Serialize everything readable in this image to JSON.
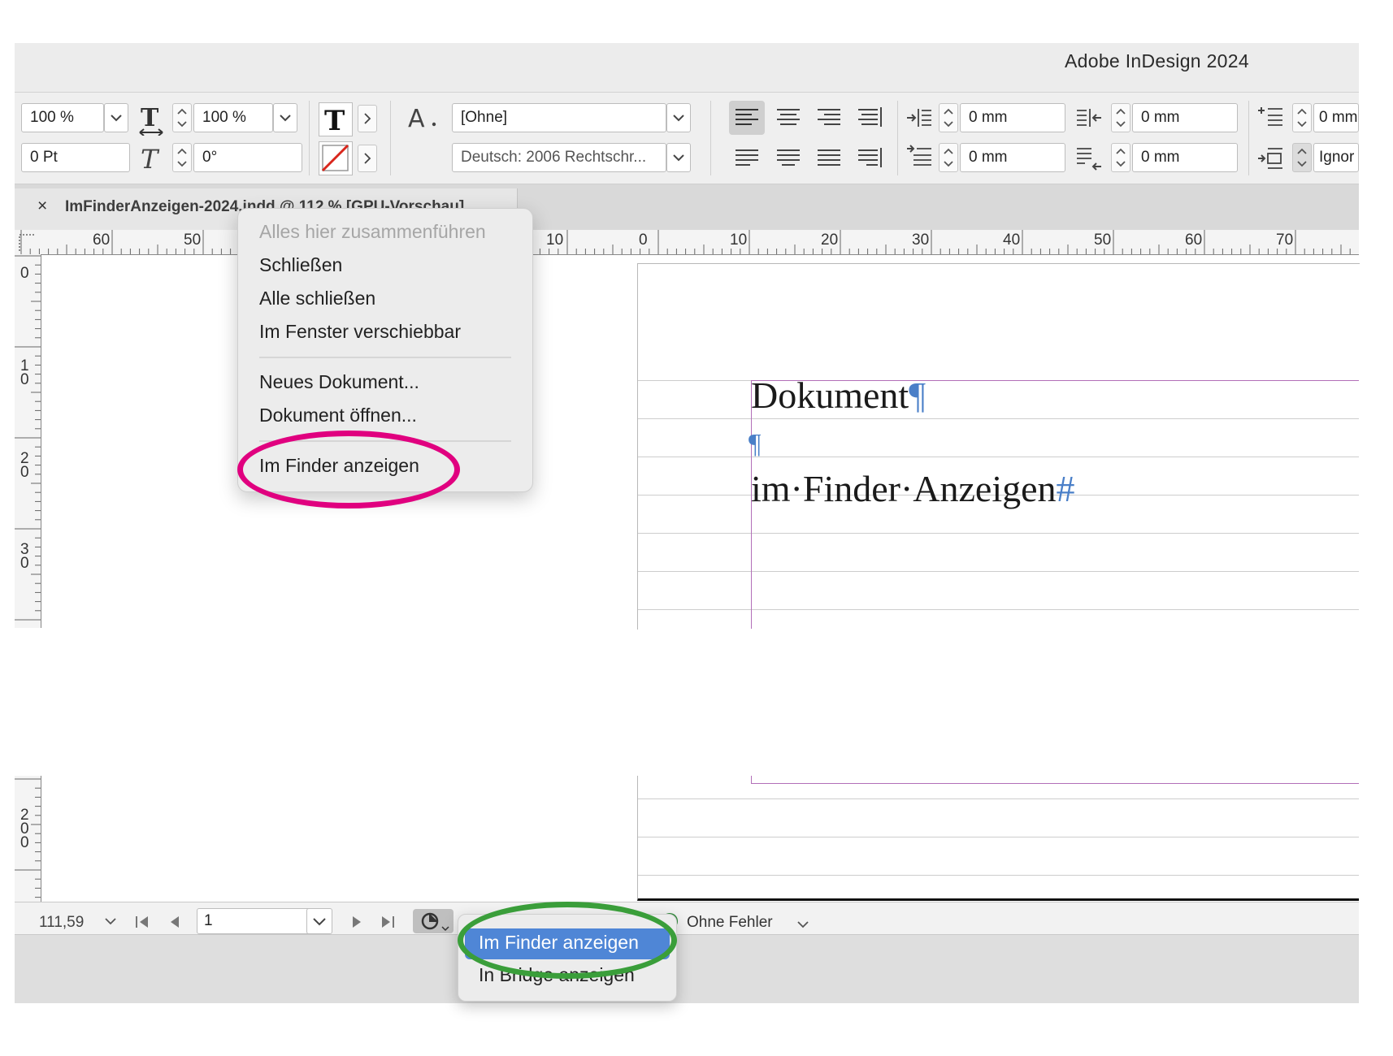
{
  "app": {
    "title": "Adobe InDesign 2024"
  },
  "control_bar": {
    "horizontal_scale": "100 %",
    "vertical_scale": "100 %",
    "baseline_shift": "0 Pt",
    "skew": "0°",
    "char_style": "[Ohne]",
    "language": "Deutsch: 2006 Rechtschr...",
    "left_indent": "0 mm",
    "right_indent": "0 mm",
    "first_line_indent": "0 mm",
    "last_line_indent": "0 mm",
    "space_before": "0 mm",
    "grid_align": "Ignor"
  },
  "tab": {
    "title": "ImFinderAnzeigen-2024.indd @ 112 % [GPU-Vorschau]",
    "close": "×"
  },
  "ruler": {
    "horizontal": [
      "60",
      "50",
      "10",
      "0",
      "10",
      "20",
      "30",
      "40",
      "50",
      "60",
      "70"
    ],
    "vertical": [
      "0",
      "1\n0",
      "2\n0",
      "3\n0"
    ],
    "vertical_bottom": [
      "2\n0\n0"
    ]
  },
  "document": {
    "line1": "Dokument",
    "line3": "im·Finder·Anzeigen",
    "pilcrow": "¶",
    "end_mark": "#"
  },
  "context_menu": {
    "items": [
      {
        "label": "Alles hier zusammenführen",
        "enabled": false
      },
      {
        "label": "Schließen",
        "enabled": true
      },
      {
        "label": "Alle schließen",
        "enabled": true
      },
      {
        "label": "Im Fenster verschiebbar",
        "enabled": true
      },
      {
        "label": "Neues Dokument...",
        "enabled": true
      },
      {
        "label": "Dokument öffnen...",
        "enabled": true
      },
      {
        "label": "Im Finder anzeigen",
        "enabled": true
      }
    ]
  },
  "status_bar": {
    "zoom": "111,59",
    "page": "1",
    "preflight": "Ohne Fehler",
    "preflight_color": "#2e8b3a"
  },
  "popup_menu": {
    "items": [
      {
        "label": "Im Finder anzeigen",
        "selected": true
      },
      {
        "label": "In Bridge anzeigen",
        "selected": false
      }
    ]
  },
  "annotations": {
    "magenta": "#e0007f",
    "green": "#3a9e3a"
  }
}
